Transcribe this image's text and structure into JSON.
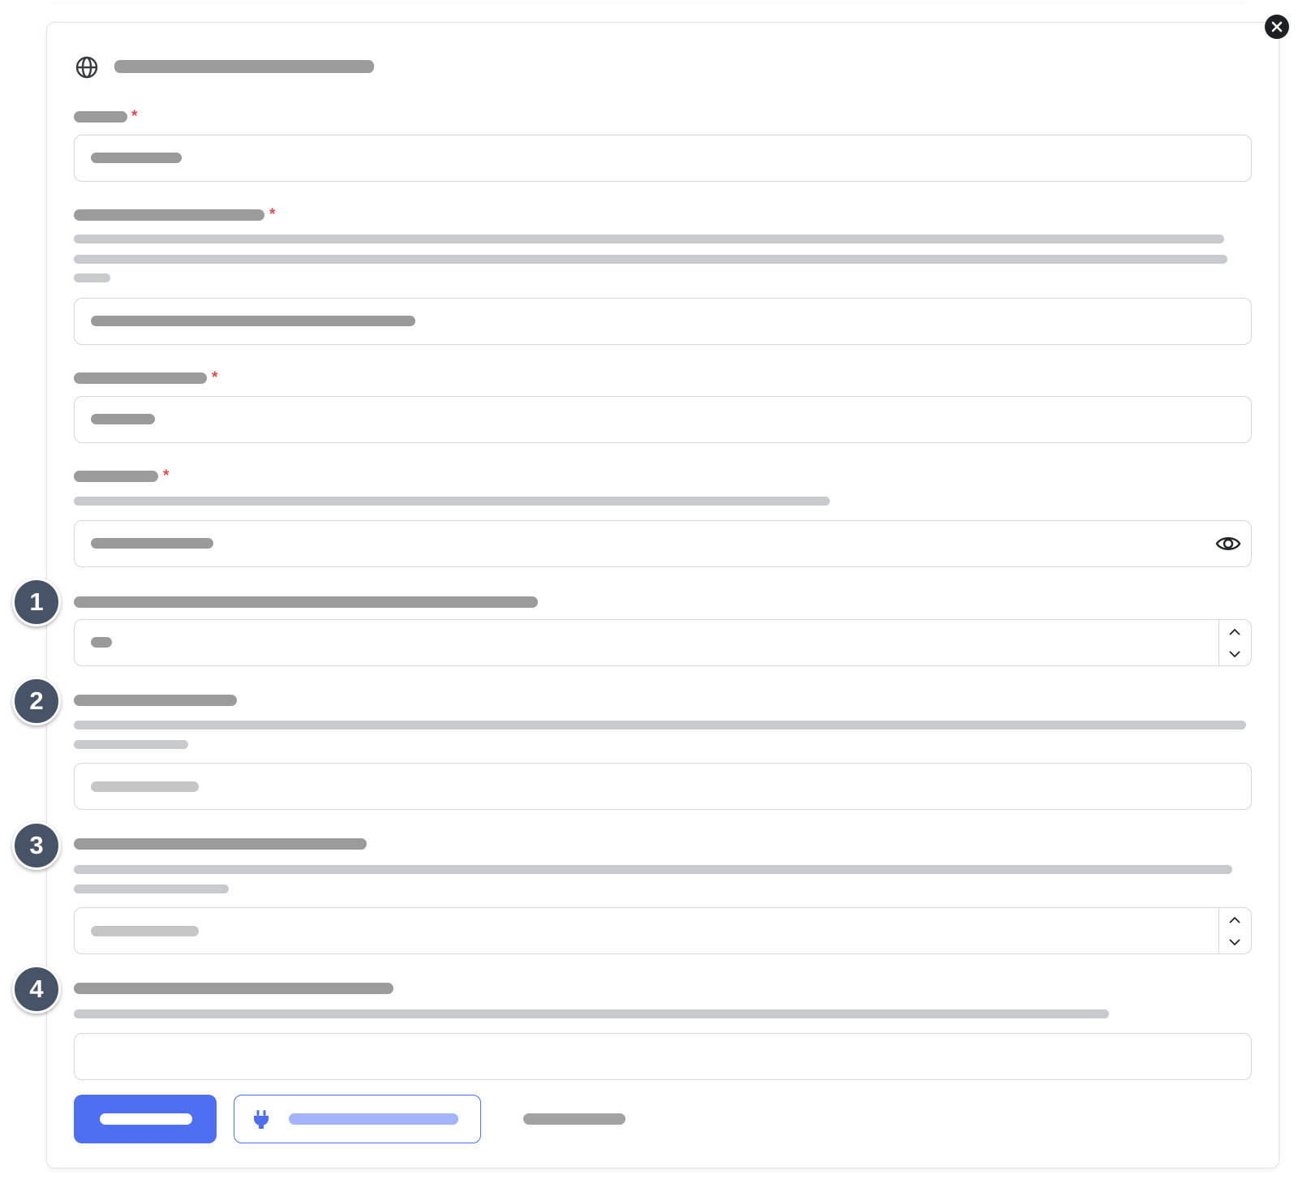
{
  "dialog": {
    "title": "",
    "icon": "globe-icon",
    "close_icon": "close-icon"
  },
  "fields": [
    {
      "label": "",
      "required": true,
      "description": "",
      "value": "",
      "placeholder": ""
    },
    {
      "label": "",
      "required": true,
      "description": "",
      "value": "",
      "placeholder": ""
    },
    {
      "label": "",
      "required": true,
      "description": "",
      "value": "",
      "placeholder": ""
    },
    {
      "label": "",
      "required": true,
      "description": "",
      "value": "",
      "placeholder": "",
      "toggle_icon": "eye-icon"
    },
    {
      "label": "",
      "required": false,
      "description": "",
      "value": "",
      "placeholder": "",
      "step": 1
    },
    {
      "label": "",
      "required": false,
      "description": "",
      "value": "",
      "placeholder": ""
    },
    {
      "label": "",
      "required": false,
      "description": "",
      "value": "",
      "placeholder": ""
    },
    {
      "label": "",
      "required": false,
      "description": "",
      "value": "",
      "placeholder": ""
    }
  ],
  "markers": [
    "1",
    "2",
    "3",
    "4"
  ],
  "required_mark": "*",
  "buttons": {
    "save_label": "",
    "test_label": "",
    "test_icon": "plug-icon",
    "cancel_label": ""
  },
  "colors": {
    "primary": "#4f6ff3",
    "required": "#e5484d",
    "badge": "#475468"
  }
}
